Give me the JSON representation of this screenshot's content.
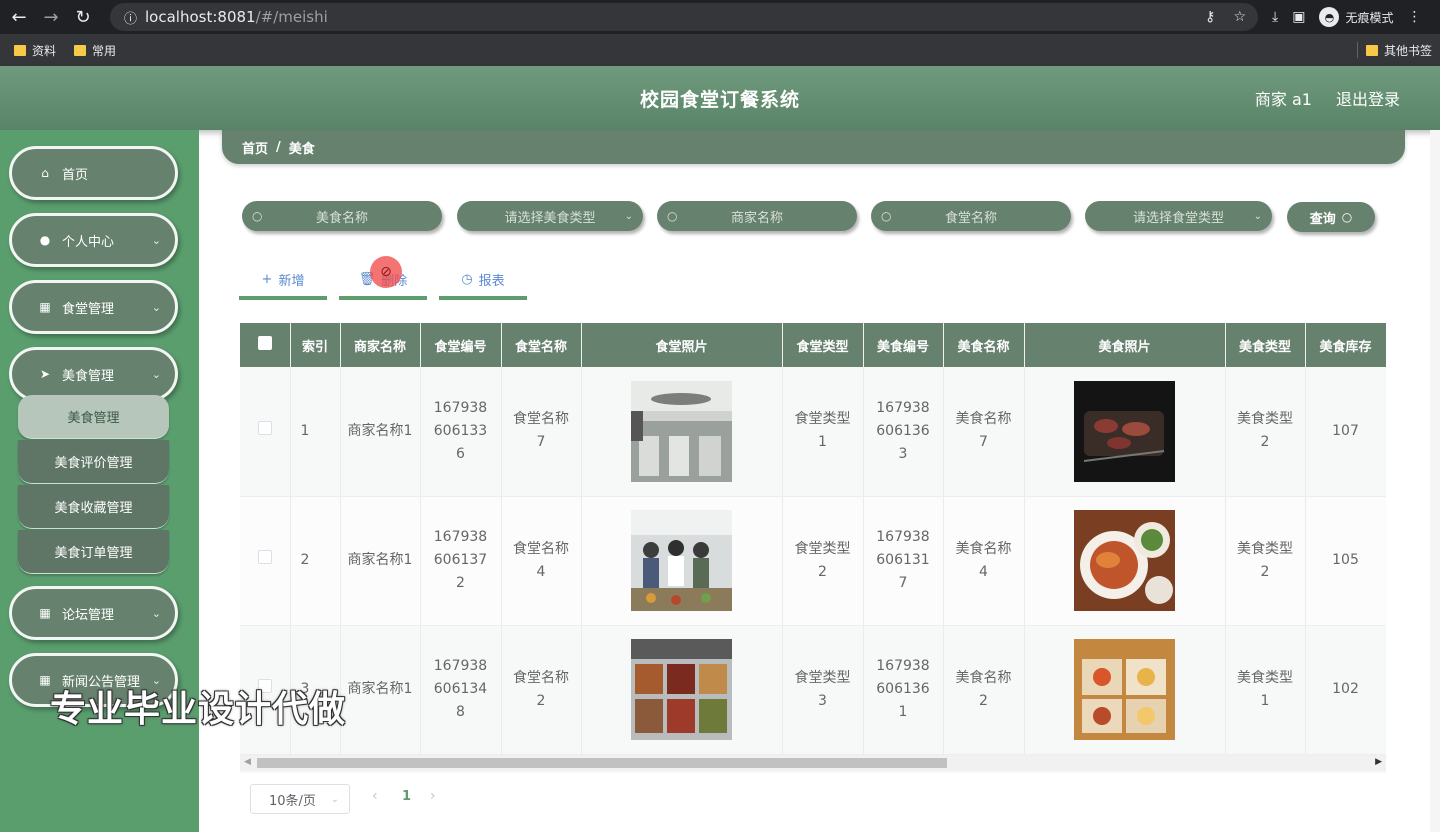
{
  "browser": {
    "url_host": "localhost:8081",
    "url_path": "/#/meishi",
    "incognito_label": "无痕模式",
    "bookmarks": [
      "资料",
      "常用"
    ],
    "other_bookmarks": "其他书签"
  },
  "header": {
    "title": "校园食堂订餐系统",
    "user": "商家 a1",
    "logout": "退出登录"
  },
  "sidebar": {
    "items": [
      {
        "label": "首页",
        "icon": "home-icon"
      },
      {
        "label": "个人中心",
        "icon": "user-icon"
      },
      {
        "label": "食堂管理",
        "icon": "grid-icon"
      },
      {
        "label": "美食管理",
        "icon": "send-icon"
      },
      {
        "label": "论坛管理",
        "icon": "grid-icon"
      },
      {
        "label": "新闻公告管理",
        "icon": "grid-icon"
      }
    ],
    "submenu": [
      "美食管理",
      "美食评价管理",
      "美食收藏管理",
      "美食订单管理"
    ]
  },
  "watermark": "专业毕业设计代做",
  "breadcrumb": {
    "home": "首页",
    "sep": "/",
    "current": "美食"
  },
  "search": {
    "food_name": "美食名称",
    "food_type": "请选择美食类型",
    "merchant_name": "商家名称",
    "canteen_name": "食堂名称",
    "canteen_type": "请选择食堂类型",
    "query": "查询"
  },
  "actions": {
    "add": "新增",
    "delete": "删除",
    "report": "报表"
  },
  "table": {
    "headers": [
      "索引",
      "商家名称",
      "食堂编号",
      "食堂名称",
      "食堂照片",
      "食堂类型",
      "美食编号",
      "美食名称",
      "美食照片",
      "美食类型",
      "美食库存"
    ],
    "rows": [
      {
        "index": "1",
        "merchant": "商家名称1",
        "canteen_no": "1679386061336",
        "canteen_name": "食堂名称7",
        "canteen_type": "食堂类型1",
        "food_no": "1679386061363",
        "food_name": "美食名称7",
        "food_type": "美食类型2",
        "stock": "107"
      },
      {
        "index": "2",
        "merchant": "商家名称1",
        "canteen_no": "1679386061372",
        "canteen_name": "食堂名称4",
        "canteen_type": "食堂类型2",
        "food_no": "1679386061317",
        "food_name": "美食名称4",
        "food_type": "美食类型2",
        "stock": "105"
      },
      {
        "index": "3",
        "merchant": "商家名称1",
        "canteen_no": "1679386061348",
        "canteen_name": "食堂名称2",
        "canteen_type": "食堂类型3",
        "food_no": "1679386061361",
        "food_name": "美食名称2",
        "food_type": "美食类型1",
        "stock": "102"
      }
    ]
  },
  "pagination": {
    "page_size": "10条/页",
    "current_page": "1"
  }
}
